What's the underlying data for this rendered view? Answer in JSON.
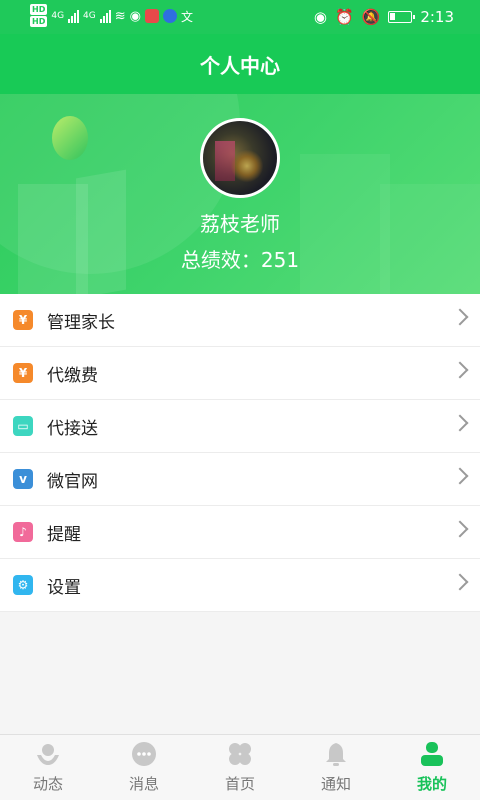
{
  "statusbar": {
    "hd1": "HD",
    "hd2": "HD",
    "net1": "4G",
    "net2": "4G",
    "time": "2:13"
  },
  "titlebar": {
    "title": "个人中心"
  },
  "profile": {
    "name": "荔枝老师",
    "score": "总绩效：251"
  },
  "menu": [
    {
      "label": "管理家长",
      "icon": "moneybag-icon",
      "color": "#f5892b",
      "glyph": "¥"
    },
    {
      "label": "代缴费",
      "icon": "moneybag-icon",
      "color": "#f5892b",
      "glyph": "¥"
    },
    {
      "label": "代接送",
      "icon": "bus-icon",
      "color": "#3dd6c0",
      "glyph": "▭"
    },
    {
      "label": "微官网",
      "icon": "vimeo-icon",
      "color": "#3b8fd8",
      "glyph": "v"
    },
    {
      "label": "提醒",
      "icon": "bell-icon",
      "color": "#f16a9a",
      "glyph": "♪"
    },
    {
      "label": "设置",
      "icon": "gear-icon",
      "color": "#31b6ef",
      "glyph": "⚙"
    }
  ],
  "tabs": [
    {
      "label": "动态",
      "icon": "hands-icon",
      "active": false
    },
    {
      "label": "消息",
      "icon": "chat-icon",
      "active": false
    },
    {
      "label": "首页",
      "icon": "clover-icon",
      "active": false
    },
    {
      "label": "通知",
      "icon": "bell-icon",
      "active": false
    },
    {
      "label": "我的",
      "icon": "person-icon",
      "active": true
    }
  ],
  "colors": {
    "primary": "#1fc95a",
    "active_tab": "#19c25a",
    "inactive_tab": "#777777"
  }
}
